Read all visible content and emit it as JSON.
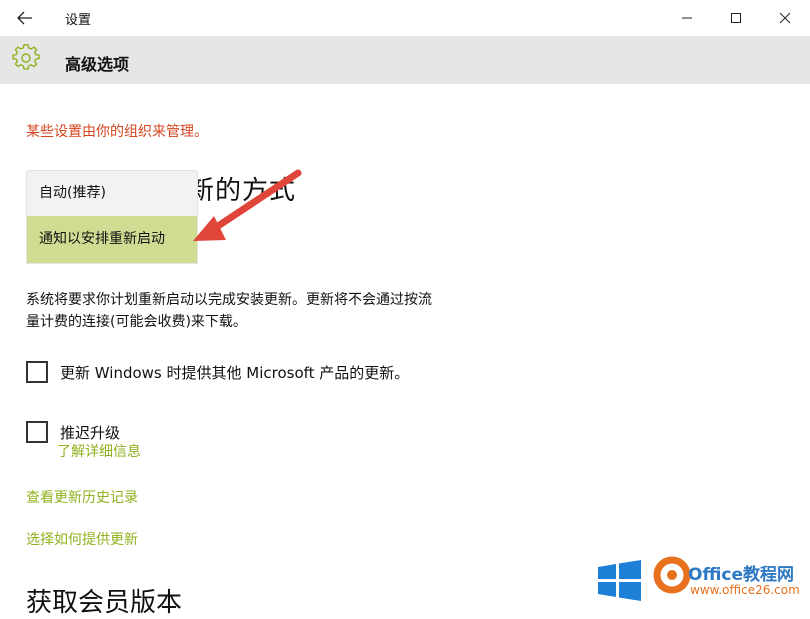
{
  "window": {
    "title": "设置",
    "back_icon": "back-arrow-icon",
    "minimize_icon": "minimize-icon",
    "maximize_icon": "maximize-icon",
    "close_icon": "close-icon"
  },
  "header": {
    "icon": "gear-icon",
    "title": "高级选项"
  },
  "managed_notice": "某些设置由你的组织来管理。",
  "section_heading_visible_part": "新的方式",
  "dropdown": {
    "options": [
      {
        "label": "自动(推荐)",
        "selected": false
      },
      {
        "label": "通知以安排重新启动",
        "selected": true
      }
    ]
  },
  "description": [
    "系统将要求你计划重新启动以完成安装更新。更新将不会通过按流",
    "量计费的连接(可能会收费)来下载。"
  ],
  "checkboxes": [
    {
      "label": "更新 Windows 时提供其他 Microsoft 产品的更新。",
      "checked": false
    },
    {
      "label": "推迟升级",
      "checked": false
    }
  ],
  "links": {
    "learn_more": "了解详细信息",
    "view_history": "查看更新历史记录",
    "choose_delivery": "选择如何提供更新"
  },
  "bottom_heading_partial": "获取会员版本",
  "colors": {
    "accent_link": "#8fb21d",
    "selected_option_bg": "#cfdd93",
    "notice_text": "#d4451e",
    "header_bg": "#e6e6e6",
    "annotation_arrow": "#e0453a"
  },
  "watermark": {
    "brand": "Office教程网",
    "url": "www.office26.com"
  }
}
